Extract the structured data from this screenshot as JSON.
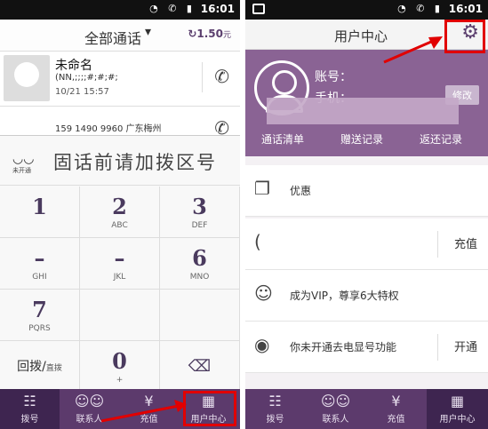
{
  "status_time": "16:01",
  "status_icons": "◔ ✆ ▮",
  "left": {
    "title": "全部通话",
    "title_chevron": "▾",
    "balance": "1.50",
    "balance_unit": "元",
    "balance_icon": "↻",
    "calls": [
      {
        "name": "未命名",
        "number": "(NN,;;;;#;#;#;",
        "time": "10/21 15:57"
      },
      {
        "name": "",
        "number": "159 1490 9960 广东梅州",
        "time": ""
      }
    ],
    "dial_hint": "固话前请加拨区号",
    "dial_caption": "未开通",
    "keys": [
      {
        "digit": "1",
        "sub": ""
      },
      {
        "digit": "2",
        "sub": "ABC"
      },
      {
        "digit": "3",
        "sub": "DEF"
      },
      {
        "digit": "4",
        "sub": "GHI"
      },
      {
        "digit": "5",
        "sub": "JKL"
      },
      {
        "digit": "6",
        "sub": "MNO"
      },
      {
        "digit": "7",
        "sub": "PQRS"
      },
      {
        "digit": "0",
        "sub": "+"
      }
    ],
    "redial_label": "回拨",
    "direct_label": "直拨",
    "tabs": [
      "拨号",
      "联系人",
      "充值",
      "用户中心"
    ]
  },
  "right": {
    "title": "用户中心",
    "account_label": "账号：",
    "phone_label": "手机：",
    "edit_label": "修改",
    "links": [
      "通话清单",
      "赠送记录",
      "返还记录"
    ],
    "menu": [
      {
        "label": "优惠",
        "action": ""
      },
      {
        "label": "",
        "action": "充值"
      },
      {
        "label": "成为VIP，尊享6大特权",
        "action": ""
      },
      {
        "label": "你未开通去电显号功能",
        "action": "开通"
      }
    ],
    "tabs": [
      "拨号",
      "联系人",
      "充值",
      "用户中心"
    ]
  },
  "icons": {
    "gear": "gear-icon",
    "phone": "phone-icon",
    "delete": "backspace-icon"
  },
  "accent_color": "#5c3a6c",
  "highlight_color": "#e10000"
}
